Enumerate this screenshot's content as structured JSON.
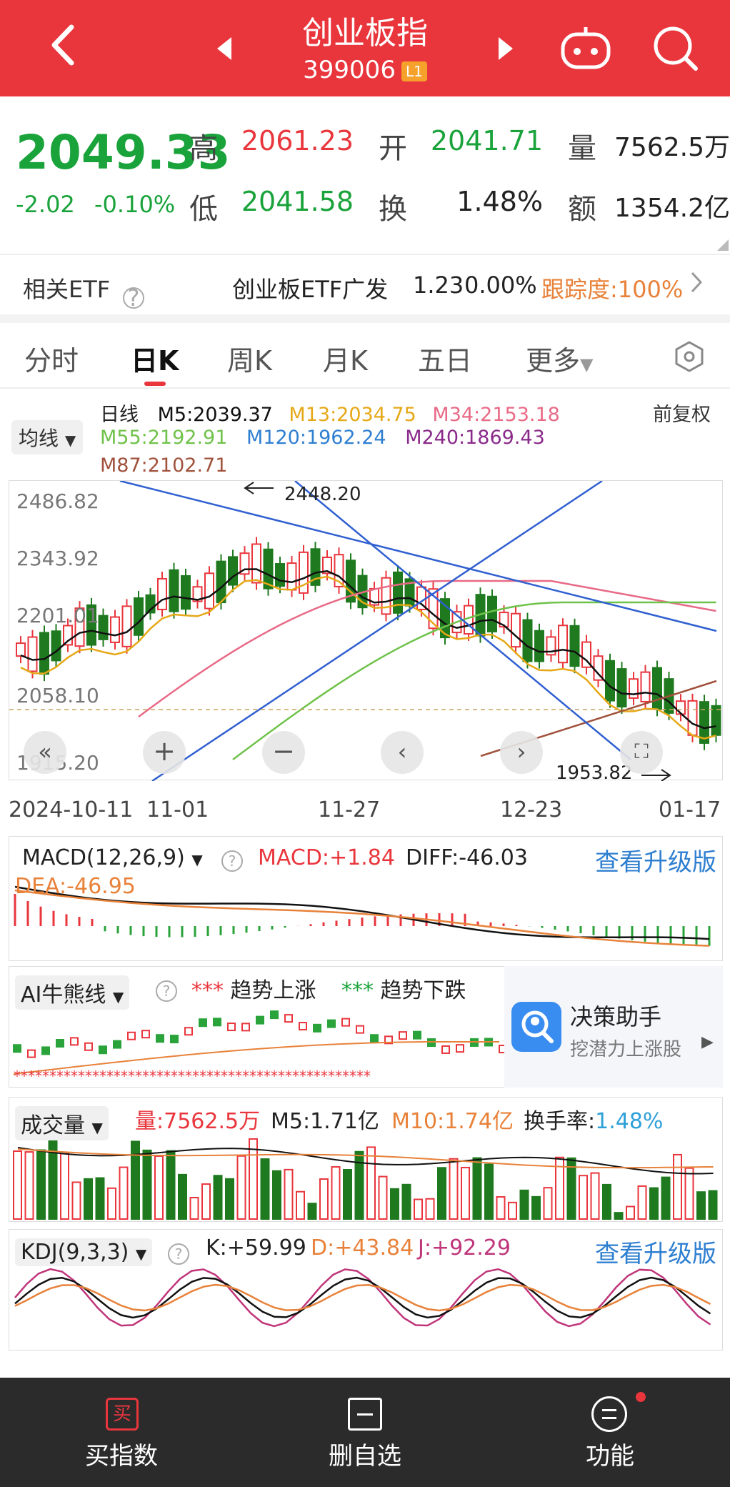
{
  "header": {
    "title": "创业板指",
    "code": "399006",
    "level_badge": "L1"
  },
  "quote": {
    "price": "2049.33",
    "change": "-2.02",
    "change_pct": "-0.10%",
    "high_label": "高",
    "high": "2061.23",
    "open_label": "开",
    "open": "2041.71",
    "vol_label": "量",
    "volume": "7562.5万",
    "low_label": "低",
    "low": "2041.58",
    "turnover_label": "换",
    "turnover": "1.48%",
    "amount_label": "额",
    "amount": "1354.2亿"
  },
  "etf": {
    "label": "相关ETF",
    "name": "创业板ETF广发",
    "price": "1.23",
    "pct": "0.00%",
    "tracking": "跟踪度:100%"
  },
  "tabs": [
    {
      "label": "分时"
    },
    {
      "label": "日K"
    },
    {
      "label": "周K"
    },
    {
      "label": "月K"
    },
    {
      "label": "五日"
    },
    {
      "label": "更多"
    }
  ],
  "ma": {
    "selector": "均线",
    "period": "日线",
    "m5": "M5:2039.37",
    "m13": "M13:2034.75",
    "m34": "M34:2153.18",
    "m55": "M55:2192.91",
    "m120": "M120:1962.24",
    "m240": "M240:1869.43",
    "m87": "M87:2102.71",
    "adjust": "前复权"
  },
  "main_chart": {
    "y_ticks": [
      "2486.82",
      "2343.92",
      "2201.01",
      "2058.10",
      "1915.20"
    ],
    "x_ticks": [
      "2024-10-11",
      "11-01",
      "11-27",
      "12-23",
      "01-17"
    ],
    "high_note": "2448.20",
    "low_note": "1953.82",
    "colors": {
      "up": "#e9363d",
      "down": "#1f7a1f",
      "m5": "#111111",
      "m13": "#e6a817",
      "m34": "#e86a86",
      "m55": "#6fc24a",
      "m120": "#2f7fd1",
      "m87": "#a0523c",
      "trend": "#3060d0"
    }
  },
  "macd": {
    "selector": "MACD(12,26,9)",
    "macd": "MACD:+1.84",
    "diff": "DIFF:-46.03",
    "dea": "DEA:-46.95",
    "upgrade": "查看升级版"
  },
  "ai": {
    "selector": "AI牛熊线",
    "up_stars": "***",
    "up_label": "趋势上涨",
    "down_stars": "***",
    "down_label": "趋势下跌",
    "assistant_title": "决策助手",
    "assistant_sub": "挖潜力上涨股"
  },
  "volume": {
    "selector": "成交量",
    "vol": "量:7562.5万",
    "m5": "M5:1.71亿",
    "m10": "M10:1.74亿",
    "turnover_label": "换手率:",
    "turnover": "1.48%"
  },
  "kdj": {
    "selector": "KDJ(9,3,3)",
    "k": "K:+59.99",
    "d": "D:+43.84",
    "j": "J:+92.29",
    "upgrade": "查看升级版"
  },
  "bottom_nav": [
    {
      "label": "买指数"
    },
    {
      "label": "删自选"
    },
    {
      "label": "功能"
    }
  ]
}
